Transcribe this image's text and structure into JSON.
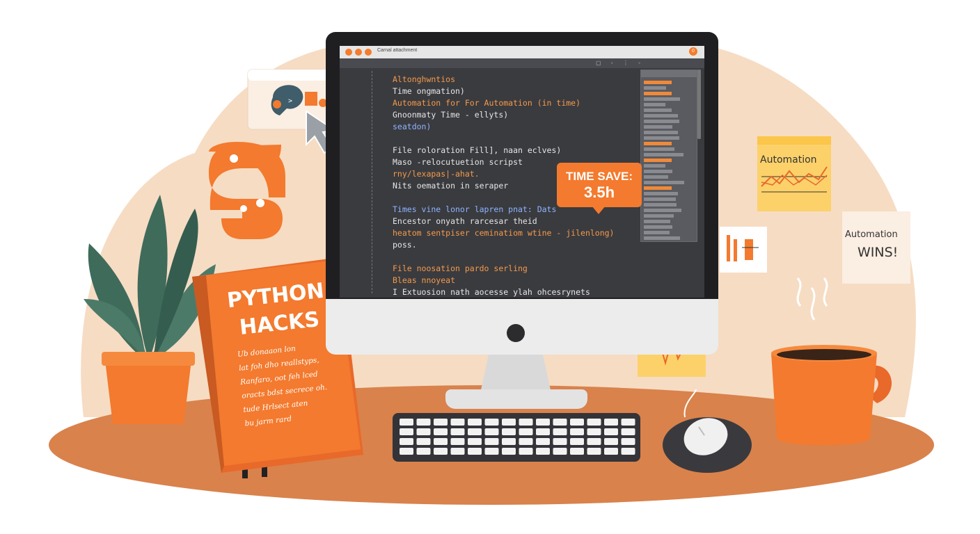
{
  "colors": {
    "accent": "#f37a2e",
    "backdrop": "#f6dcc3",
    "desk": "#d9824c",
    "screen": "#3a3b3f",
    "code_orange": "#f59a4a",
    "code_white": "#e6e6e6",
    "code_blue": "#8fb4ff",
    "leaf": "#3f6b5b"
  },
  "editor": {
    "title": "Carnal attachment",
    "toolbar_text": "",
    "window_button": "0",
    "code_lines": [
      {
        "text": "Altonghwntios",
        "color": "o"
      },
      {
        "text": "Time ongmation)",
        "color": "w"
      },
      {
        "text": "Automation for For Automation (in time)",
        "color": "o"
      },
      {
        "text": "Gnoonmaty Time - ellyts)",
        "color": "w"
      },
      {
        "text": "seatdon)",
        "color": "b"
      },
      {
        "text": "",
        "color": "w"
      },
      {
        "text": "File roloration Fill], naan eclves)",
        "color": "w"
      },
      {
        "text": "Maso -relocutuetion scripst",
        "color": "w"
      },
      {
        "text": "rny/lexapas|-ahat.",
        "color": "o"
      },
      {
        "text": "Nits oemation in seraper",
        "color": "w"
      },
      {
        "text": "",
        "color": "w"
      },
      {
        "text": "Times vine lonor lapren pnat: Dats",
        "color": "b"
      },
      {
        "text": "Encestor onyath rarcesar theid",
        "color": "w"
      },
      {
        "text": "heatom sentpiser ceminatiom wtine - jilenlong)",
        "color": "o"
      },
      {
        "text": "poss.",
        "color": "w"
      },
      {
        "text": "",
        "color": "w"
      },
      {
        "text": "File noosation pardo serling",
        "color": "o"
      },
      {
        "text": "Bleas nnoyeat",
        "color": "o"
      },
      {
        "text": "I Extuosion nath aocesse ylah ohcesrynets",
        "color": "w"
      }
    ]
  },
  "callout": {
    "line1": "TIME SAVE:",
    "line2": "3.5h"
  },
  "book": {
    "title_line1": "PYTHON",
    "title_line2": "HACKS",
    "notes": [
      "Ub donaaon lon",
      "lat foh dho reallstyps,",
      "Ranfaro, oot feh lced",
      "oracts bdst secrece oh.",
      "tude Hrlsect aten",
      "bu jarm rard"
    ]
  },
  "sticky_note_1": {
    "title": "Automation"
  },
  "sticky_note_2": {
    "line1": "Automation",
    "line2": "WINS!"
  },
  "icons": [
    "python-logo-icon",
    "cursor-arrow-icon",
    "window-popup-icon",
    "plant-icon",
    "coffee-mug-icon",
    "keyboard-icon",
    "mouse-icon",
    "waveform-icon",
    "chart-note-icon"
  ]
}
